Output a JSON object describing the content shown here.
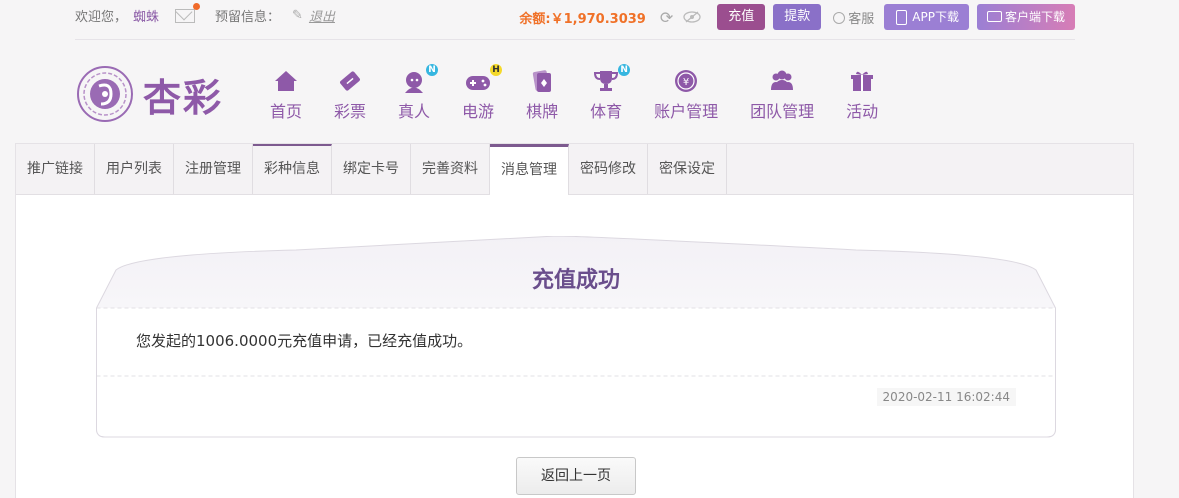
{
  "topbar": {
    "welcome": "欢迎您，",
    "username": "蜘蛛",
    "reserved_label": "预留信息：",
    "logout": "退出",
    "balance_label": "余额:",
    "balance": "￥1,970.3039",
    "recharge": "充值",
    "withdraw": "提款",
    "service": "客服",
    "app_download": "APP下载",
    "client_download": "客户端下载"
  },
  "logo": {
    "text": "杏彩"
  },
  "nav": [
    {
      "label": "首页",
      "icon": "home-icon"
    },
    {
      "label": "彩票",
      "icon": "ticket-icon"
    },
    {
      "label": "真人",
      "icon": "dealer-icon",
      "badge": "N"
    },
    {
      "label": "电游",
      "icon": "gamepad-icon",
      "badge": "H"
    },
    {
      "label": "棋牌",
      "icon": "cards-icon"
    },
    {
      "label": "体育",
      "icon": "trophy-icon",
      "badge": "N"
    },
    {
      "label": "账户管理",
      "icon": "yen-coin-icon"
    },
    {
      "label": "团队管理",
      "icon": "team-icon"
    },
    {
      "label": "活动",
      "icon": "gift-icon"
    }
  ],
  "tabs": [
    "推广链接",
    "用户列表",
    "注册管理",
    "彩种信息",
    "绑定卡号",
    "完善资料",
    "消息管理",
    "密码修改",
    "密保设定"
  ],
  "active_tab": "消息管理",
  "message": {
    "title": "充值成功",
    "body": "您发起的1006.0000元充值申请，已经充值成功。",
    "time": "2020-02-11 16:02:44"
  },
  "back_button": "返回上一页",
  "colors": {
    "brand": "#8e59a8",
    "balance": "#f07128",
    "recharge": "#9b4e8f",
    "withdraw": "#8a70c8"
  }
}
